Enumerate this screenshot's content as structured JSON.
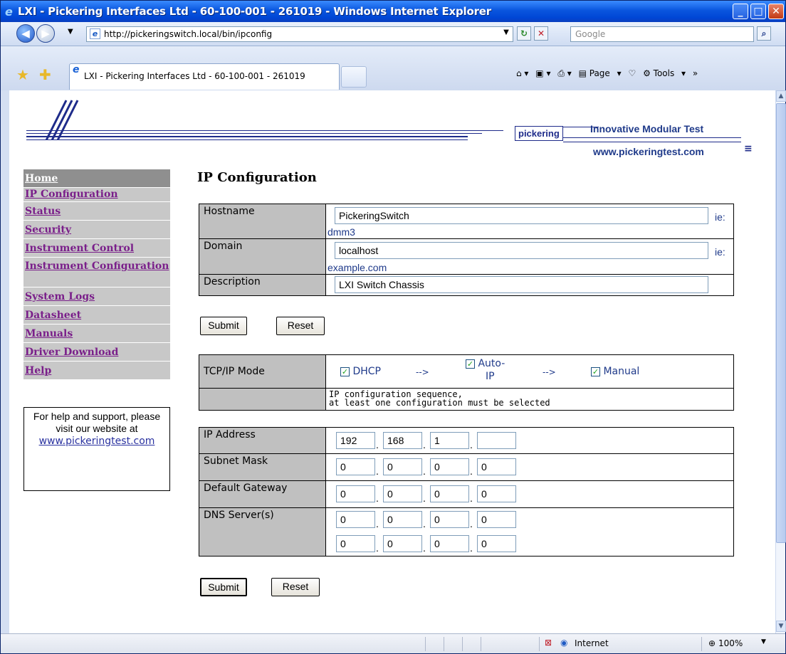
{
  "window": {
    "title": "LXI - Pickering Interfaces Ltd - 60-100-001 - 261019 - Windows Internet Explorer"
  },
  "toolbar": {
    "url": "http://pickeringswitch.local/bin/ipconfig",
    "search_placeholder": "Google",
    "tab_title": "LXI - Pickering Interfaces Ltd - 60-100-001 - 261019",
    "page_label": "Page",
    "tools_label": "Tools"
  },
  "banner": {
    "brand": "pickering",
    "tagline": "Innovative Modular Test",
    "website": "www.pickeringtest.com"
  },
  "sidebar": {
    "items": [
      {
        "label": "Home"
      },
      {
        "label": "IP Configuration"
      },
      {
        "label": "Status"
      },
      {
        "label": "Security"
      },
      {
        "label": "Instrument Control"
      },
      {
        "label": "Instrument Configuration"
      },
      {
        "label": "System Logs"
      },
      {
        "label": "Datasheet"
      },
      {
        "label": "Manuals"
      },
      {
        "label": "Driver Download"
      },
      {
        "label": "Help"
      }
    ],
    "help_text": "For help and support, please visit our website at",
    "help_link": "www.pickeringtest.com"
  },
  "main": {
    "title": "IP Configuration",
    "hostname_label": "Hostname",
    "hostname_value": "PickeringSwitch",
    "hostname_hint_prefix": "ie:",
    "hostname_hint": "dmm3",
    "domain_label": "Domain",
    "domain_value": "localhost",
    "domain_hint_prefix": "ie:",
    "domain_hint": "example.com",
    "description_label": "Description",
    "description_value": "LXI Switch Chassis",
    "submit_label": "Submit",
    "reset_label": "Reset",
    "tcp_label": "TCP/IP Mode",
    "dhcp_label": "DHCP",
    "autoip_label_1": "Auto-",
    "autoip_label_2": "IP",
    "manual_label": "Manual",
    "arrow": "-->",
    "tcp_note_1": "IP configuration sequence,",
    "tcp_note_2": "at least one configuration must be selected",
    "ip_label": "IP Address",
    "ip": [
      "192",
      "168",
      "1",
      ""
    ],
    "subnet_label": "Subnet Mask",
    "subnet": [
      "0",
      "0",
      "0",
      "0"
    ],
    "gateway_label": "Default Gateway",
    "gateway": [
      "0",
      "0",
      "0",
      "0"
    ],
    "dns_label": "DNS Server(s)",
    "dns1": [
      "0",
      "0",
      "0",
      "0"
    ],
    "dns2": [
      "0",
      "0",
      "0",
      "0"
    ],
    "submit2_label": "Submit",
    "reset2_label": "Reset"
  },
  "status": {
    "zone": "Internet",
    "zoom": "100%"
  },
  "colors": {
    "titlebar": "#0a56de",
    "nav_link": "#7a1f8a",
    "label_bg": "#c0c0c0",
    "brand_blue": "#1e2b8a"
  }
}
